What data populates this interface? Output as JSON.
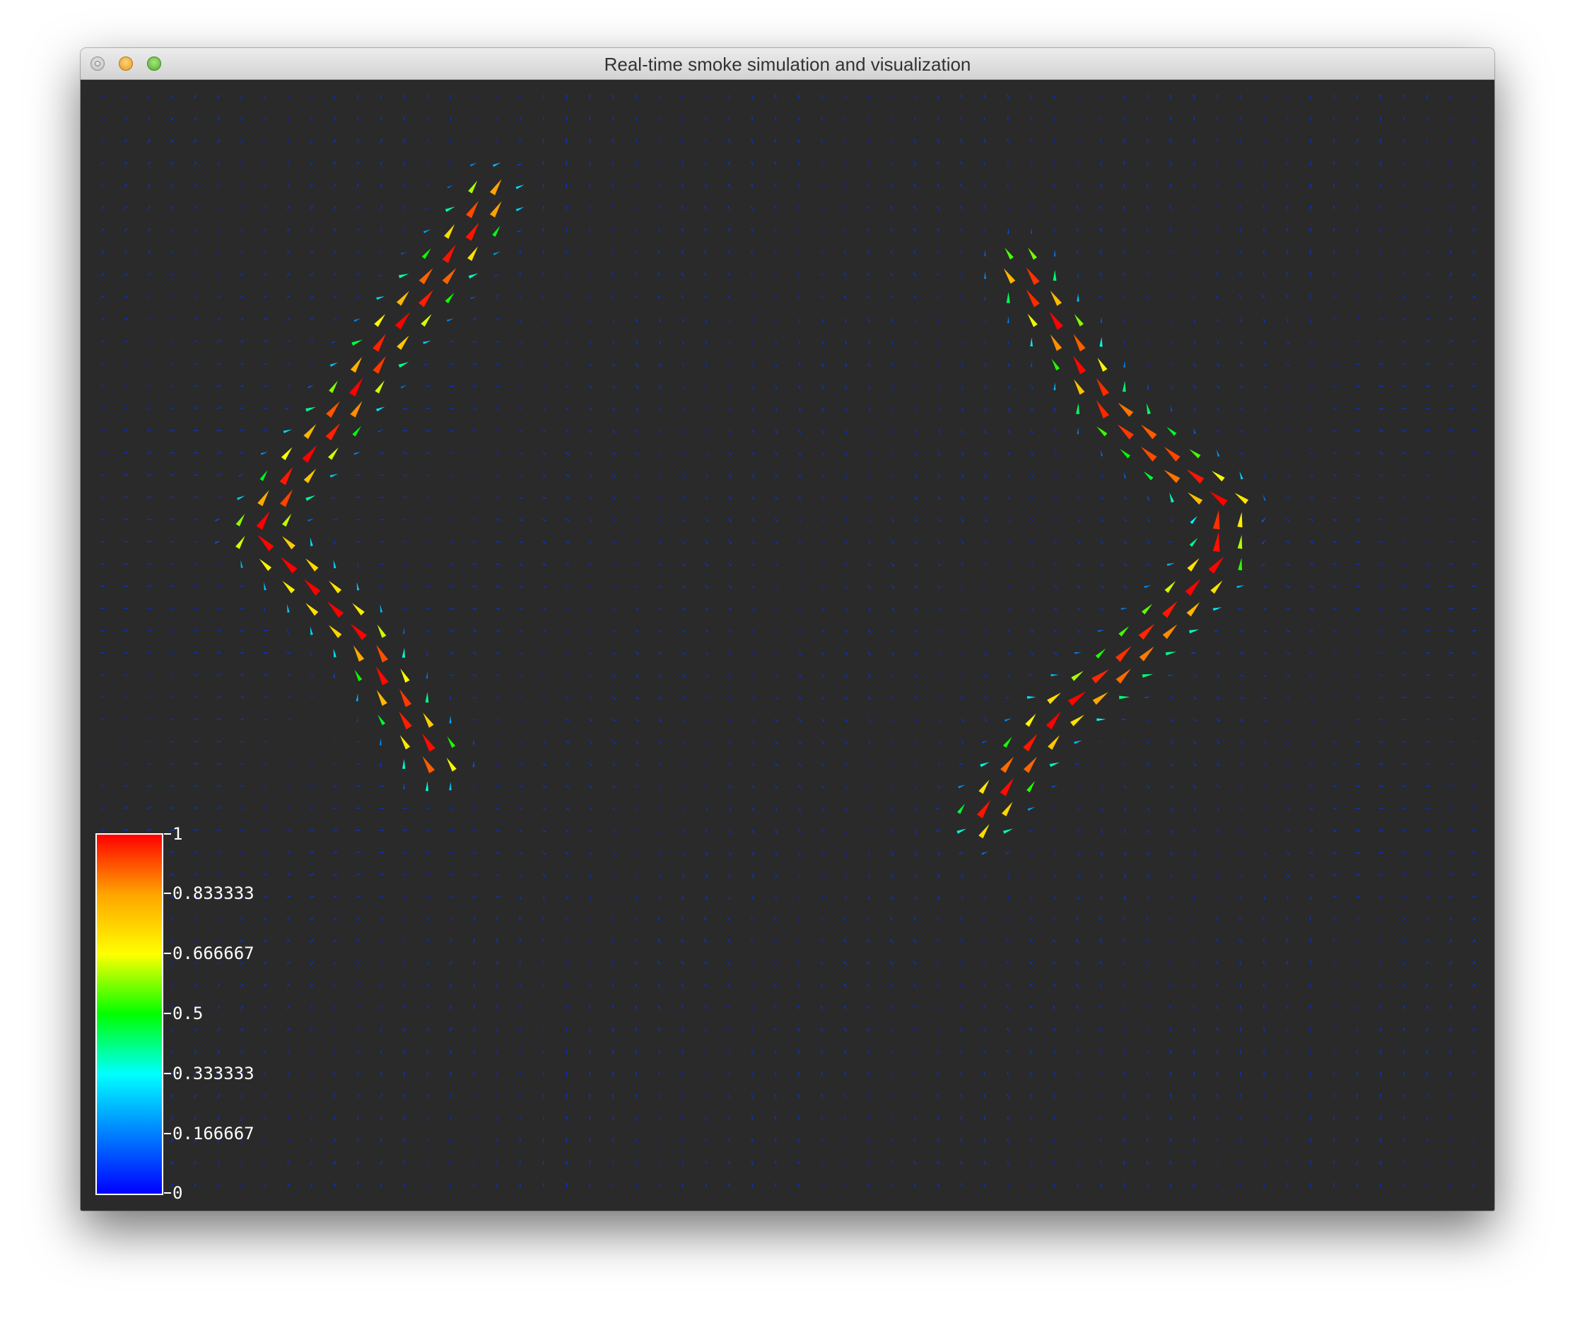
{
  "window": {
    "title": "Real-time smoke simulation and visualization",
    "buttons": [
      {
        "name": "close",
        "color": "#c8c8c8"
      },
      {
        "name": "minimize",
        "color": "#f5b13b"
      },
      {
        "name": "zoom",
        "color": "#71c950"
      }
    ]
  },
  "visualization": {
    "type": "velocity glyph field",
    "background": "#2a2a2a",
    "glyph": "cone-arrow",
    "grid": {
      "cols": 60,
      "rows": 50
    }
  },
  "colorbar": {
    "min": 0,
    "max": 1,
    "colors": [
      "#0000ff",
      "#00ffff",
      "#00ff00",
      "#ffff00",
      "#ffa500",
      "#ff0000"
    ],
    "ticks": [
      {
        "value": 1,
        "label": "1"
      },
      {
        "value": 0.833333,
        "label": "0.833333"
      },
      {
        "value": 0.666667,
        "label": "0.666667"
      },
      {
        "value": 0.5,
        "label": "0.5"
      },
      {
        "value": 0.333333,
        "label": "0.333333"
      },
      {
        "value": 0.166667,
        "label": "0.166667"
      },
      {
        "value": 0,
        "label": "0"
      }
    ]
  }
}
